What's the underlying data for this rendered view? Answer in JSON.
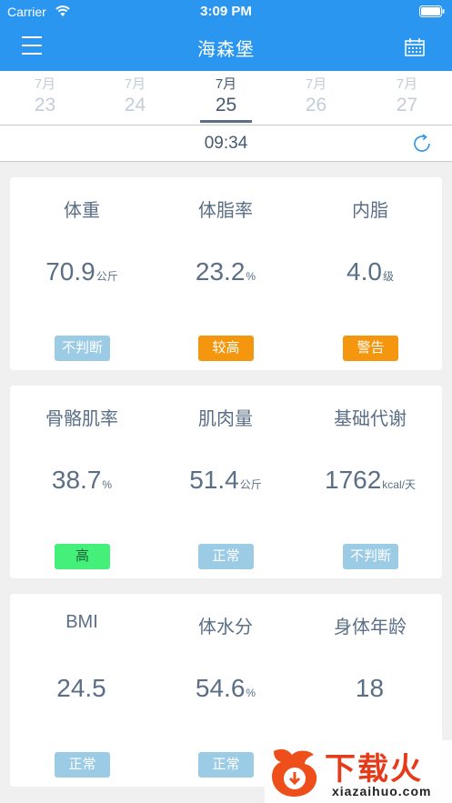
{
  "status_bar": {
    "carrier": "Carrier",
    "time": "3:09 PM"
  },
  "nav": {
    "title": "海森堡",
    "menu_icon": "menu-icon",
    "calendar_icon": "calendar-icon"
  },
  "dates": [
    {
      "month": "7月",
      "day": "23"
    },
    {
      "month": "7月",
      "day": "24"
    },
    {
      "month": "7月",
      "day": "25",
      "active": true
    },
    {
      "month": "7月",
      "day": "26"
    },
    {
      "month": "7月",
      "day": "27"
    }
  ],
  "measure_time": "09:34",
  "cards": [
    [
      {
        "label": "体重",
        "value": "70.9",
        "unit": "公斤",
        "status": "不判断",
        "status_color": "#9ccbe6"
      },
      {
        "label": "体脂率",
        "value": "23.2",
        "unit": "%",
        "status": "较高",
        "status_color": "#f5960f"
      },
      {
        "label": "内脂",
        "value": "4.0",
        "unit": "级",
        "status": "警告",
        "status_color": "#f5960f"
      }
    ],
    [
      {
        "label": "骨骼肌率",
        "value": "38.7",
        "unit": "%",
        "status": "高",
        "status_color": "#44f079"
      },
      {
        "label": "肌肉量",
        "value": "51.4",
        "unit": "公斤",
        "status": "正常",
        "status_color": "#9ccbe6"
      },
      {
        "label": "基础代谢",
        "value": "1762",
        "unit": "kcal/天",
        "status": "不判断",
        "status_color": "#9ccbe6"
      }
    ],
    [
      {
        "label": "BMI",
        "value": "24.5",
        "unit": "",
        "status": "正常",
        "status_color": "#9ccbe6"
      },
      {
        "label": "体水分",
        "value": "54.6",
        "unit": "%",
        "status": "正常",
        "status_color": "#9ccbe6"
      },
      {
        "label": "身体年龄",
        "value": "18",
        "unit": "",
        "status": "",
        "status_color": ""
      }
    ]
  ],
  "watermark": {
    "title": "下载火",
    "subtitle": "xiazaihuo.com"
  },
  "colors": {
    "header": "#2a96f0",
    "text": "#5a6f86",
    "background": "#f0f0f0"
  }
}
